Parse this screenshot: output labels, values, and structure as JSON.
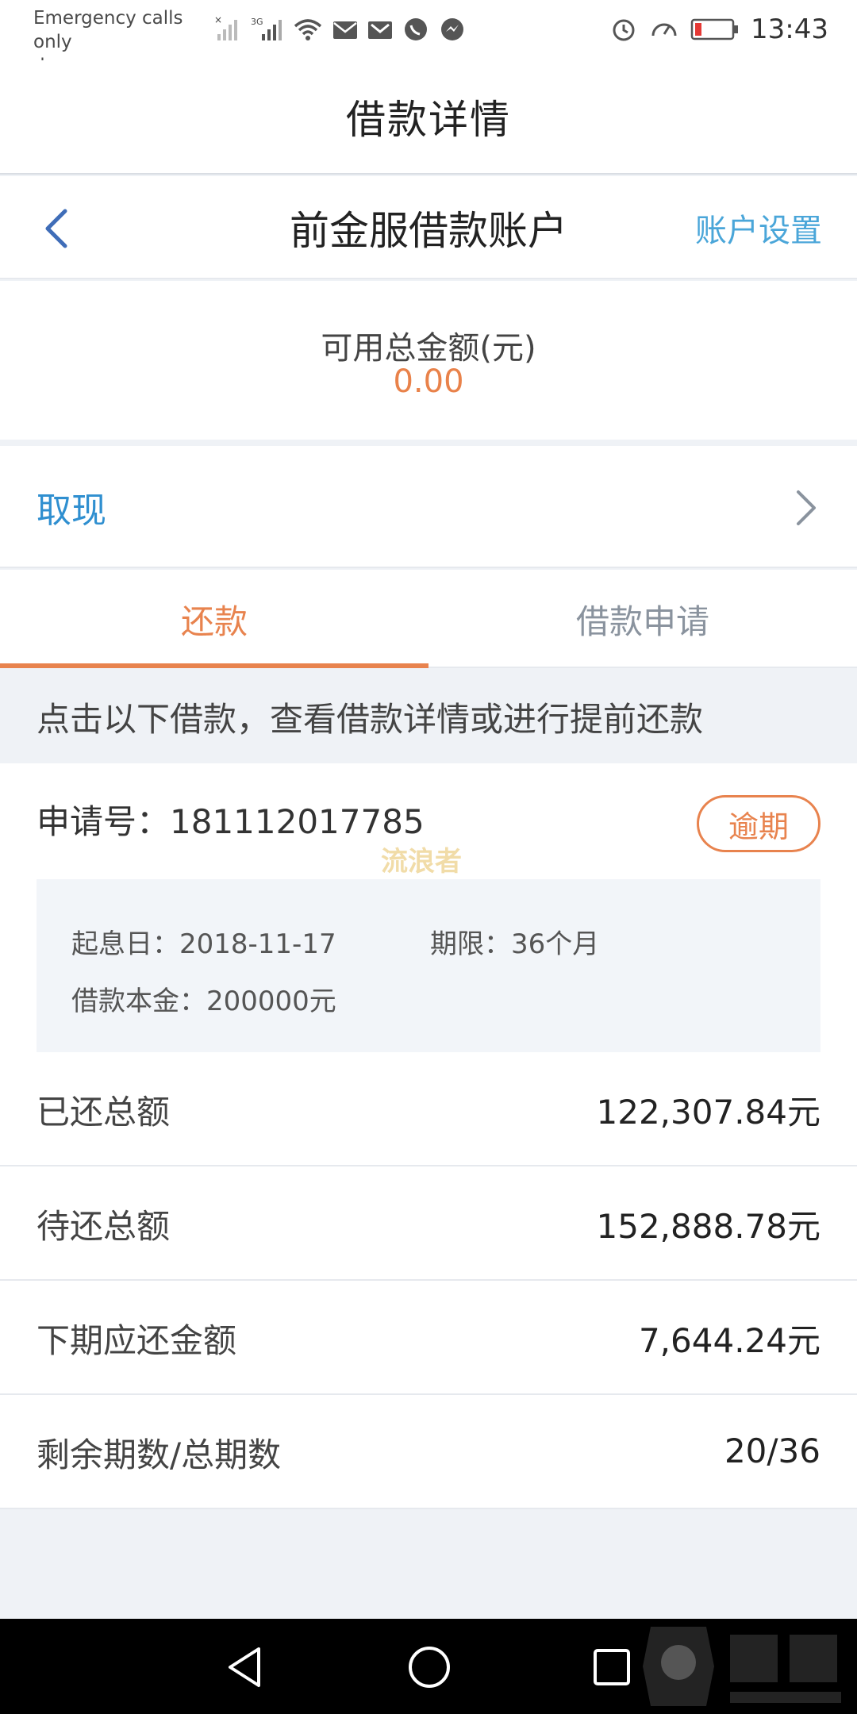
{
  "status_bar": {
    "carrier_line1": "Emergency calls only",
    "carrier_line2": "du",
    "network_label": "3G",
    "time": "13:43"
  },
  "page": {
    "title": "借款详情"
  },
  "account": {
    "title": "前金服借款账户",
    "settings_label": "账户设置"
  },
  "balance": {
    "label": "可用总金额(元)",
    "value": "0.00"
  },
  "withdraw": {
    "label": "取现"
  },
  "tabs": [
    {
      "label": "还款",
      "active": true
    },
    {
      "label": "借款申请",
      "active": false
    }
  ],
  "hint": "点击以下借款，查看借款详情或进行提前还款",
  "loan": {
    "application_no": "申请号：181112017785",
    "status_badge": "逾期",
    "watermark": "流浪者",
    "start_date": "起息日：2018-11-17",
    "term": "期限：36个月",
    "principal": "借款本金：200000元",
    "rows": [
      {
        "label": "已还总额",
        "value": "122,307.84元"
      },
      {
        "label": "待还总额",
        "value": "152,888.78元"
      },
      {
        "label": "下期应还金额",
        "value": "7,644.24元"
      },
      {
        "label": "剩余期数/总期数",
        "value": "20/36"
      }
    ]
  },
  "colors": {
    "accent_orange": "#e8834e",
    "link_blue": "#4aa6d9",
    "withdraw_blue": "#2f8fd0"
  }
}
